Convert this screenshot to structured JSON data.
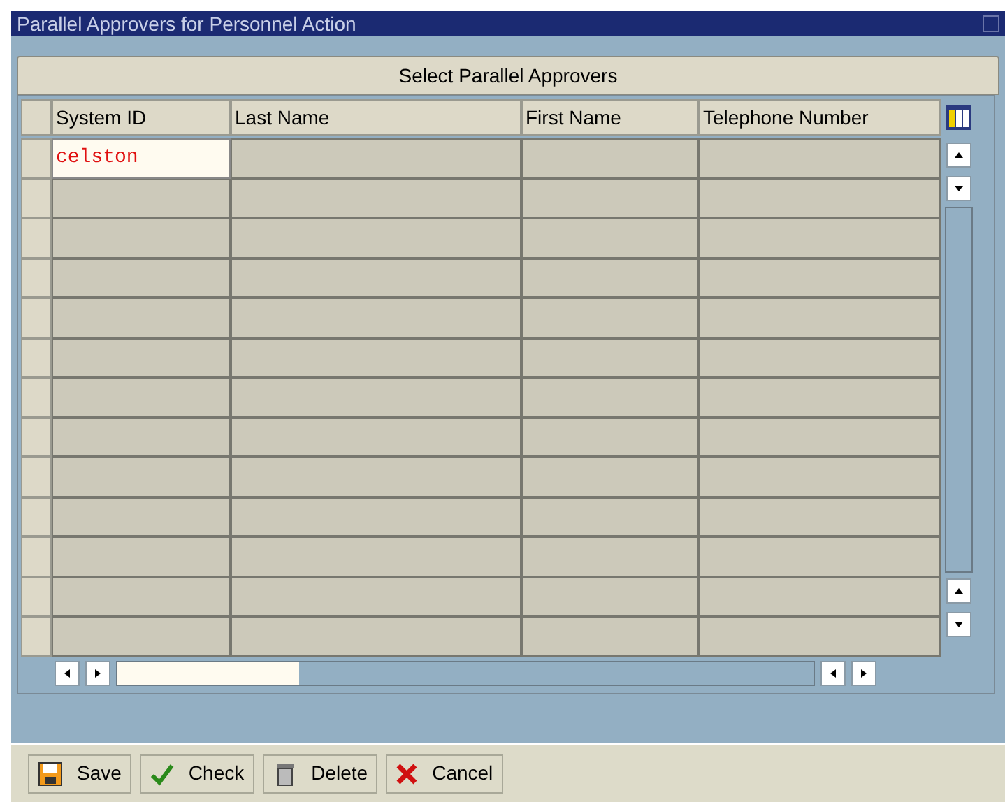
{
  "window": {
    "title": "Parallel Approvers for Personnel Action"
  },
  "table": {
    "title": "Select Parallel Approvers",
    "columns": [
      "System ID",
      "Last Name",
      "First Name",
      "Telephone Number"
    ],
    "rows": [
      {
        "system_id": "celston"
      }
    ]
  },
  "buttons": [
    {
      "kind": "save",
      "label": "Save"
    },
    {
      "kind": "check",
      "label": "Check"
    },
    {
      "kind": "delete",
      "label": "Delete"
    },
    {
      "kind": "cancel",
      "label": "Cancel"
    }
  ]
}
